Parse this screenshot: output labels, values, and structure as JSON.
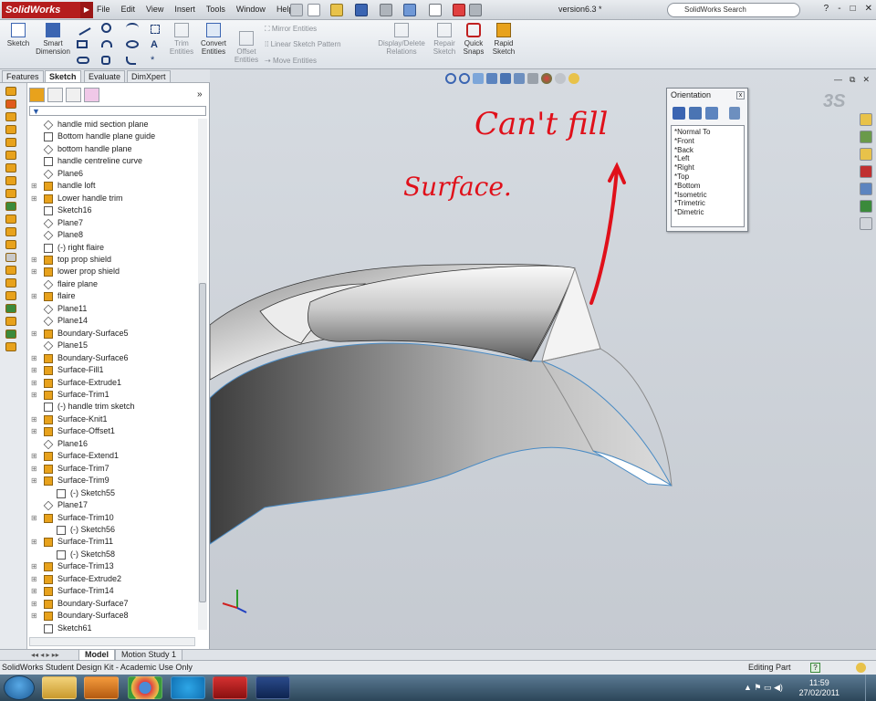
{
  "app": {
    "logo": "SolidWorks",
    "menus": [
      "File",
      "Edit",
      "View",
      "Insert",
      "Tools",
      "Window",
      "Help"
    ],
    "document_title": "version6.3 *",
    "search_placeholder": "SolidWorks Search",
    "window_controls": [
      "?",
      "-",
      "□",
      "✕"
    ]
  },
  "ribbon": {
    "sketch": "Sketch",
    "smart_dimension": "Smart Dimension",
    "trim_entities": "Trim Entities",
    "convert_entities": "Convert Entities",
    "offset_entities": "Offset Entities",
    "mirror_entities": "Mirror Entities",
    "linear_sketch_pattern": "Linear Sketch Pattern",
    "move_entities": "Move Entities",
    "display_delete_relations": "Display/Delete Relations",
    "repair_sketch": "Repair Sketch",
    "quick_snaps": "Quick Snaps",
    "rapid_sketch": "Rapid Sketch"
  },
  "tabs": [
    "Features",
    "Sketch",
    "Evaluate",
    "DimXpert"
  ],
  "active_tab": "Sketch",
  "tree": [
    {
      "label": "handle mid section plane",
      "icon": "plane",
      "indent": 0
    },
    {
      "label": "Bottom handle plane guide",
      "icon": "sketch",
      "indent": 0
    },
    {
      "label": "bottom handle plane",
      "icon": "plane",
      "indent": 0
    },
    {
      "label": "handle centreline curve",
      "icon": "curve",
      "indent": 0
    },
    {
      "label": "Plane6",
      "icon": "plane",
      "indent": 0
    },
    {
      "label": "handle loft",
      "icon": "loft",
      "indent": 0
    },
    {
      "label": "Lower handle trim",
      "icon": "surface",
      "indent": 0
    },
    {
      "label": "Sketch16",
      "icon": "sketch",
      "indent": 0
    },
    {
      "label": "Plane7",
      "icon": "plane",
      "indent": 0
    },
    {
      "label": "Plane8",
      "icon": "plane",
      "indent": 0
    },
    {
      "label": "(-) right flaire",
      "icon": "sketch",
      "indent": 0
    },
    {
      "label": "top prop shield",
      "icon": "surface",
      "indent": 0
    },
    {
      "label": "lower prop shield",
      "icon": "surface",
      "indent": 0
    },
    {
      "label": "flaire plane",
      "icon": "plane",
      "indent": 0
    },
    {
      "label": "flaire",
      "icon": "surface",
      "indent": 0
    },
    {
      "label": "Plane11",
      "icon": "plane",
      "indent": 0
    },
    {
      "label": "Plane14",
      "icon": "plane",
      "indent": 0
    },
    {
      "label": "Boundary-Surface5",
      "icon": "boundary",
      "indent": 0
    },
    {
      "label": "Plane15",
      "icon": "plane",
      "indent": 0
    },
    {
      "label": "Boundary-Surface6",
      "icon": "boundary",
      "indent": 0
    },
    {
      "label": "Surface-Fill1",
      "icon": "surface",
      "indent": 0
    },
    {
      "label": "Surface-Extrude1",
      "icon": "surface",
      "indent": 0
    },
    {
      "label": "Surface-Trim1",
      "icon": "surface",
      "indent": 0
    },
    {
      "label": "(-) handle trim sketch",
      "icon": "sketch",
      "indent": 0
    },
    {
      "label": "Surface-Knit1",
      "icon": "knit",
      "indent": 0
    },
    {
      "label": "Surface-Offset1",
      "icon": "surface",
      "indent": 0
    },
    {
      "label": "Plane16",
      "icon": "plane",
      "indent": 0
    },
    {
      "label": "Surface-Extend1",
      "icon": "surface",
      "indent": 0
    },
    {
      "label": "Surface-Trim7",
      "icon": "surface",
      "indent": 0
    },
    {
      "label": "Surface-Trim9",
      "icon": "surface",
      "indent": 0
    },
    {
      "label": "(-) Sketch55",
      "icon": "sketch",
      "indent": 1
    },
    {
      "label": "Plane17",
      "icon": "plane",
      "indent": 0
    },
    {
      "label": "Surface-Trim10",
      "icon": "surface",
      "indent": 0
    },
    {
      "label": "(-) Sketch56",
      "icon": "sketch",
      "indent": 1
    },
    {
      "label": "Surface-Trim11",
      "icon": "surface",
      "indent": 0
    },
    {
      "label": "(-) Sketch58",
      "icon": "sketch",
      "indent": 1
    },
    {
      "label": "Surface-Trim13",
      "icon": "surface",
      "indent": 0
    },
    {
      "label": "Surface-Extrude2",
      "icon": "surface",
      "indent": 0
    },
    {
      "label": "Surface-Trim14",
      "icon": "surface",
      "indent": 0
    },
    {
      "label": "Boundary-Surface7",
      "icon": "boundary",
      "indent": 0
    },
    {
      "label": "Boundary-Surface8",
      "icon": "boundary",
      "indent": 0
    },
    {
      "label": "Sketch61",
      "icon": "sketch",
      "indent": 0
    }
  ],
  "orientation": {
    "title": "Orientation",
    "views": [
      "*Normal To",
      "*Front",
      "*Back",
      "*Left",
      "*Right",
      "*Top",
      "*Bottom",
      "*Isometric",
      "*Trimetric",
      "*Dimetric"
    ]
  },
  "annotation": {
    "line1": "Can't fill",
    "line2": "Surface.",
    "color": "#e0101a"
  },
  "bottom_tabs": [
    "Model",
    "Motion Study 1"
  ],
  "status": {
    "left": "SolidWorks Student Design Kit - Academic Use Only",
    "right": "Editing Part"
  },
  "taskbar": {
    "time": "11:59",
    "date": "27/02/2011"
  },
  "colors": {
    "sw_red": "#b51d1d",
    "tree_icon_yellow": "#e8a21c",
    "edge_blue": "#4a8bc4"
  }
}
